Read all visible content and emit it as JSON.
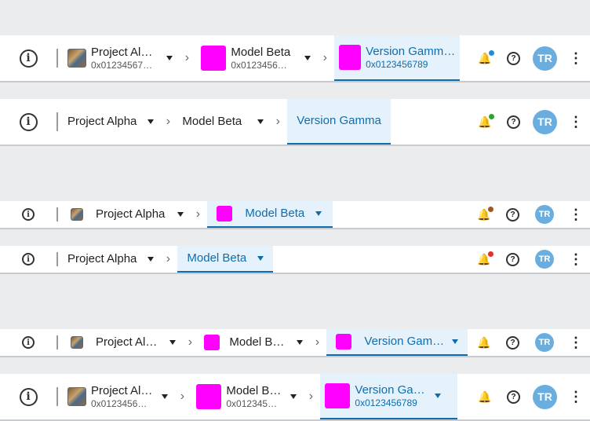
{
  "bars": [
    {
      "project": "Project Al…",
      "project_hash": "0x01234567…",
      "model": "Model Beta",
      "model_hash": "0x0123456…",
      "version": "Version Gamm…",
      "version_hash": "0x0123456789",
      "avatar": "TR",
      "dot_color": "#1a8fd8"
    },
    {
      "project": "Project Alpha",
      "model": "Model Beta",
      "version": "Version Gamma",
      "avatar": "TR",
      "dot_color": "#2aa52a"
    },
    {
      "project": "Project Alpha",
      "model": "Model Beta",
      "avatar": "TR",
      "dot_color": "#a0581a"
    },
    {
      "project": "Project Alpha",
      "model": "Model Beta",
      "avatar": "TR",
      "dot_color": "#e03030"
    },
    {
      "project": "Project Al…",
      "model": "Model B…",
      "version": "Version Gam…",
      "avatar": "TR"
    },
    {
      "project": "Project Al…",
      "project_hash": "0x0123456…",
      "model": "Model B…",
      "model_hash": "0x012345…",
      "version": "Version Ga…",
      "version_hash": "0x0123456789",
      "avatar": "TR"
    }
  ],
  "icons": {
    "logo": "info-logo-icon",
    "chevron": "chevron-right-icon",
    "bell": "bell-icon",
    "help": "help-icon",
    "more": "more-vertical-icon"
  }
}
